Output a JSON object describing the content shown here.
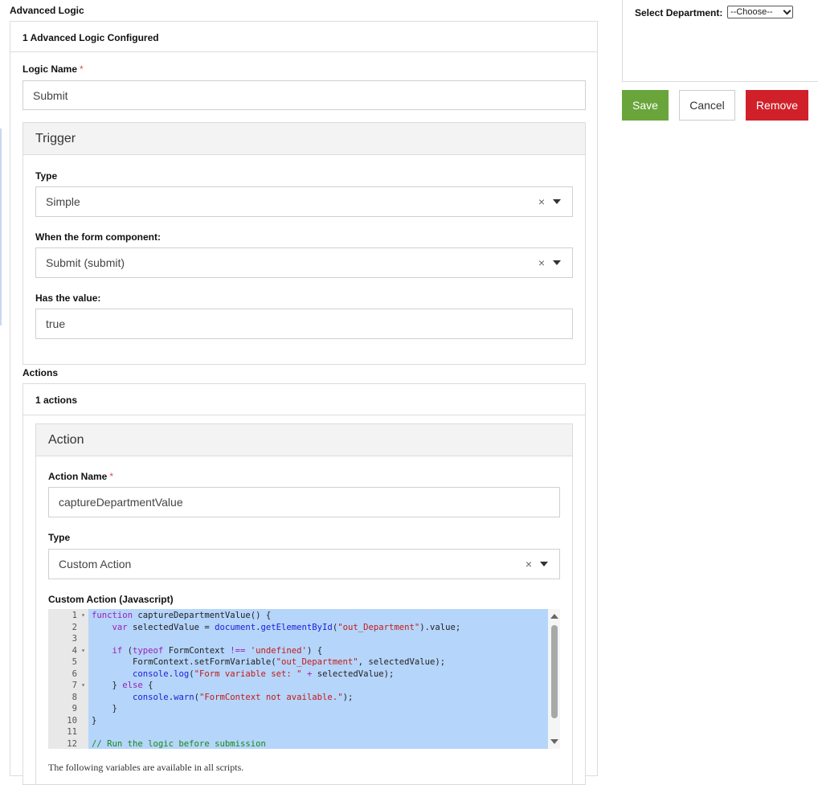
{
  "header": {
    "title": "Advanced Logic"
  },
  "logic_count_label": "1 Advanced Logic Configured",
  "logic_name": {
    "label": "Logic Name",
    "required_mark": "*",
    "value": "Submit"
  },
  "trigger": {
    "title": "Trigger",
    "type_label": "Type",
    "type_value": "Simple",
    "component_label": "When the form component:",
    "component_value": "Submit (submit)",
    "value_label": "Has the value:",
    "value_value": "true"
  },
  "actions": {
    "title": "Actions",
    "count_label": "1 actions",
    "action": {
      "title": "Action",
      "name_label": "Action Name",
      "required_mark": "*",
      "name_value": "captureDepartmentValue",
      "type_label": "Type",
      "type_value": "Custom Action",
      "script_label": "Custom Action (Javascript)"
    },
    "footer_note": "The following variables are available in all scripts."
  },
  "clear_glyph": "×",
  "preview": {
    "label": "Select Department:",
    "selected_option": "--Choose--"
  },
  "buttons": {
    "save": "Save",
    "cancel": "Cancel",
    "remove": "Remove"
  },
  "colors": {
    "save": "#6aa53b",
    "remove": "#d0202a"
  },
  "code": {
    "line_numbers": [
      "1",
      "2",
      "3",
      "4",
      "5",
      "6",
      "7",
      "8",
      "9",
      "10",
      "11",
      "12"
    ],
    "lines": [
      [
        [
          "kw",
          "function"
        ],
        [
          "id",
          " captureDepartmentValue() {"
        ]
      ],
      [
        [
          "id",
          "    "
        ],
        [
          "kw",
          "var"
        ],
        [
          "id",
          " selectedValue = "
        ],
        [
          "fn",
          "document"
        ],
        [
          "id",
          "."
        ],
        [
          "fn",
          "getElementById"
        ],
        [
          "id",
          "("
        ],
        [
          "str",
          "\"out_Department\""
        ],
        [
          "id",
          ").value;"
        ]
      ],
      [],
      [
        [
          "id",
          "    "
        ],
        [
          "kw",
          "if"
        ],
        [
          "id",
          " ("
        ],
        [
          "kw",
          "typeof"
        ],
        [
          "id",
          " FormContext "
        ],
        [
          "kw",
          "!=="
        ],
        [
          "id",
          " "
        ],
        [
          "str",
          "'undefined'"
        ],
        [
          "id",
          ") {"
        ]
      ],
      [
        [
          "id",
          "        FormContext.setFormVariable("
        ],
        [
          "str",
          "\"out_Department\""
        ],
        [
          "id",
          ", selectedValue);"
        ]
      ],
      [
        [
          "id",
          "        "
        ],
        [
          "fn",
          "console"
        ],
        [
          "id",
          "."
        ],
        [
          "fn",
          "log"
        ],
        [
          "id",
          "("
        ],
        [
          "str",
          "\"Form variable set: \""
        ],
        [
          "id",
          " "
        ],
        [
          "kw",
          "+"
        ],
        [
          "id",
          " selectedValue);"
        ]
      ],
      [
        [
          "id",
          "    } "
        ],
        [
          "kw",
          "else"
        ],
        [
          "id",
          " {"
        ]
      ],
      [
        [
          "id",
          "        "
        ],
        [
          "fn",
          "console"
        ],
        [
          "id",
          "."
        ],
        [
          "fn",
          "warn"
        ],
        [
          "id",
          "("
        ],
        [
          "str",
          "\"FormContext not available.\""
        ],
        [
          "id",
          ");"
        ]
      ],
      [
        [
          "id",
          "    }"
        ]
      ],
      [
        [
          "id",
          "}"
        ]
      ],
      [],
      [
        [
          "cm",
          "// Run the logic before submission"
        ]
      ]
    ],
    "fold_lines": [
      1,
      4,
      7
    ]
  }
}
